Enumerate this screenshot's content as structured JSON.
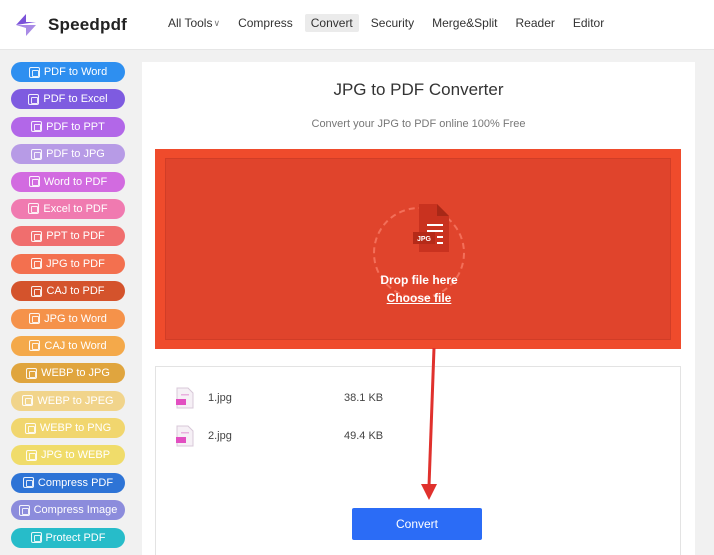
{
  "app": {
    "name": "Speedpdf"
  },
  "nav": [
    {
      "label": "All Tools",
      "caret": true,
      "active": false
    },
    {
      "label": "Compress",
      "caret": false,
      "active": false
    },
    {
      "label": "Convert",
      "caret": false,
      "active": true
    },
    {
      "label": "Security",
      "caret": false,
      "active": false
    },
    {
      "label": "Merge&Split",
      "caret": false,
      "active": false
    },
    {
      "label": "Reader",
      "caret": false,
      "active": false
    },
    {
      "label": "Editor",
      "caret": false,
      "active": false
    }
  ],
  "sidebar": [
    {
      "label": "PDF to Word",
      "color": "#2e8ff0"
    },
    {
      "label": "PDF to Excel",
      "color": "#7e5be0"
    },
    {
      "label": "PDF to PPT",
      "color": "#b267e8"
    },
    {
      "label": "PDF to JPG",
      "color": "#b79be6"
    },
    {
      "label": "Word to PDF",
      "color": "#d26be0"
    },
    {
      "label": "Excel to PDF",
      "color": "#f07ab0"
    },
    {
      "label": "PPT to PDF",
      "color": "#f06e6e"
    },
    {
      "label": "JPG to PDF",
      "color": "#f3704f"
    },
    {
      "label": "CAJ to PDF",
      "color": "#d4532c"
    },
    {
      "label": "JPG to Word",
      "color": "#f5924a"
    },
    {
      "label": "CAJ to Word",
      "color": "#f4a94a"
    },
    {
      "label": "WEBP to JPG",
      "color": "#e0a53e"
    },
    {
      "label": "WEBP to JPEG",
      "color": "#f1d48b"
    },
    {
      "label": "WEBP to PNG",
      "color": "#f1d66e"
    },
    {
      "label": "JPG to WEBP",
      "color": "#f0dc6a"
    },
    {
      "label": "Compress PDF",
      "color": "#2e74d6"
    },
    {
      "label": "Compress Image",
      "color": "#8c8cdc"
    },
    {
      "label": "Protect PDF",
      "color": "#27bcc9"
    }
  ],
  "main": {
    "title": "JPG to PDF Converter",
    "subtitle": "Convert your JPG to PDF online 100% Free",
    "drop_text": "Drop file here",
    "choose_file": "Choose file",
    "file_badge": "JPG",
    "files": [
      {
        "name": "1.jpg",
        "size": "38.1 KB"
      },
      {
        "name": "2.jpg",
        "size": "49.4 KB"
      }
    ],
    "convert_label": "Convert"
  },
  "colors": {
    "accent": "#2b6cf6",
    "dropzone": "#ef4b2c",
    "arrow": "#e0312d"
  }
}
